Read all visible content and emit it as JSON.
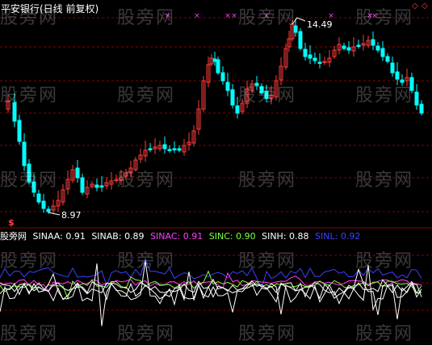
{
  "header": {
    "title": "平安银行(日线 前复权)"
  },
  "price_chart": {
    "high_label": "14.49",
    "low_label": "8.97",
    "signal_marker": "$",
    "top_marker": "×",
    "corner_icons": [
      "diamond-icon",
      "diamond-icon"
    ],
    "colors": {
      "up": "#ff3b3b",
      "down": "#00ffff",
      "grid": "#8b0000",
      "marker": "#ff40ff",
      "label": "#ffffff"
    }
  },
  "indicator": {
    "name": "股旁网",
    "items": [
      {
        "label": "SINAA:",
        "value": "0.91",
        "color": "#ffffff"
      },
      {
        "label": "SINAB:",
        "value": "0.89",
        "color": "#ffffff"
      },
      {
        "label": "SINAC:",
        "value": "0.91",
        "color": "#ff40ff"
      },
      {
        "label": "SINC:",
        "value": "0.90",
        "color": "#80ff40"
      },
      {
        "label": "SINH:",
        "value": "0.88",
        "color": "#ffffff"
      },
      {
        "label": "SINL:",
        "value": "0.92",
        "color": "#4040ff"
      }
    ]
  },
  "watermark": {
    "text": "股旁网"
  }
}
